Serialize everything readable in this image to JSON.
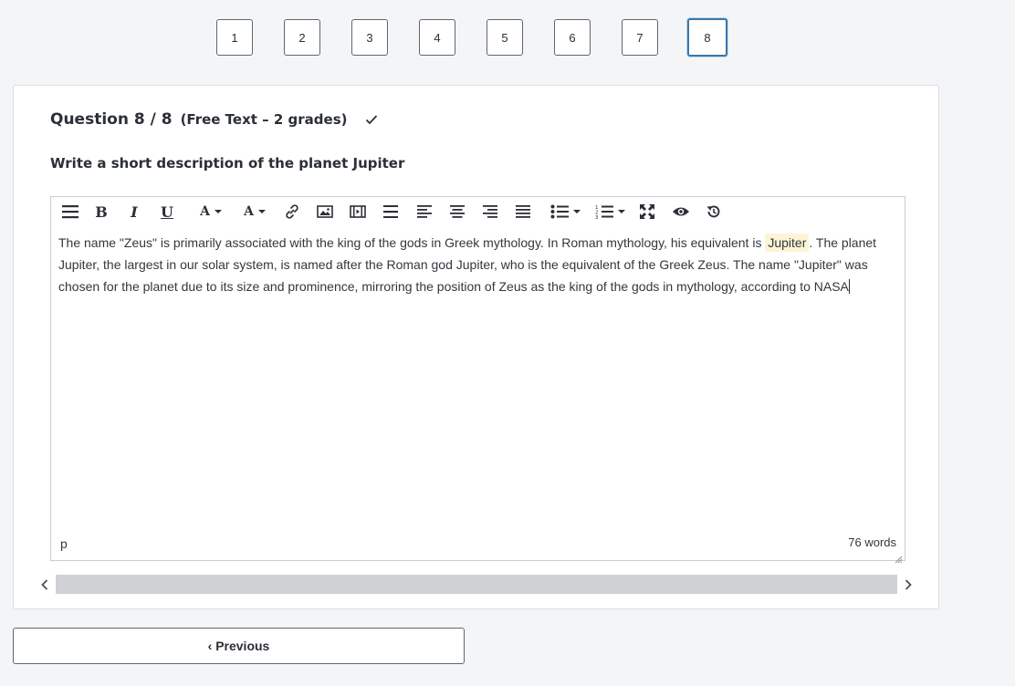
{
  "pager": {
    "pages": [
      "1",
      "2",
      "3",
      "4",
      "5",
      "6",
      "7",
      "8"
    ],
    "active": "8"
  },
  "question": {
    "title": "Question 8 / 8",
    "type": "(Free Text – 2 grades)",
    "prompt": "Write a short description of the planet Jupiter"
  },
  "toolbar": {
    "bold_label": "B",
    "italic_label": "I",
    "underline_label": "U",
    "font_color_label": "A",
    "bg_color_label": "A",
    "icons": [
      "paragraph-menu-icon",
      "bold-icon",
      "italic-icon",
      "underline-icon",
      "font-color-icon",
      "background-color-icon",
      "link-icon",
      "image-icon",
      "media-icon",
      "horizontal-rule-icon",
      "align-left-icon",
      "align-center-icon",
      "align-right-icon",
      "align-justify-icon",
      "bullet-list-icon",
      "numbered-list-icon",
      "fullscreen-icon",
      "preview-icon",
      "restore-icon"
    ]
  },
  "editor": {
    "text_before": "The name \"Zeus\" is primarily associated with the king of the gods in Greek mythology. In Roman mythology, his equivalent is ",
    "highlighted_word": "Jupiter",
    "text_after": ". The planet Jupiter, the largest in our solar system, is named after the Roman god Jupiter, who is the equivalent of the Greek Zeus. The name \"Jupiter\" was chosen for the planet due to its size and prominence, mirroring the position of Zeus as the king of the gods in mythology, according to NASA",
    "status_path": "p",
    "word_count": "76 words"
  },
  "navigation": {
    "previous_label": "‹ Previous"
  },
  "colors": {
    "accent": "#3a77a8",
    "highlight": "#fdf4d6",
    "border": "#5f6670"
  }
}
